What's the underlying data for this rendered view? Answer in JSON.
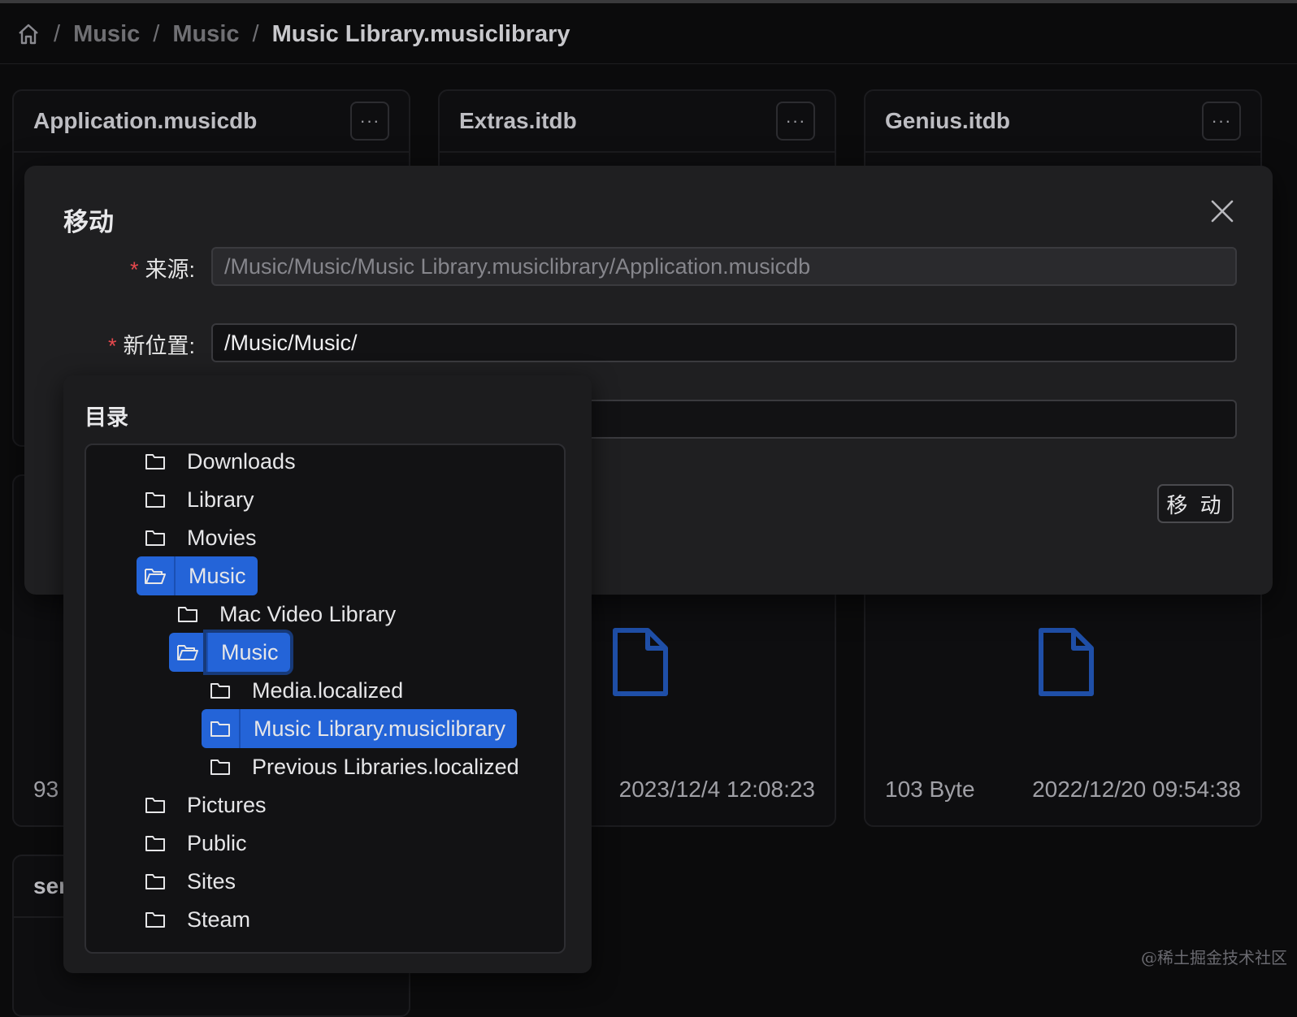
{
  "breadcrumb": {
    "home_icon": "home-icon",
    "items": [
      "Music",
      "Music",
      "Music Library.musiclibrary"
    ],
    "separator": "/"
  },
  "cards": [
    {
      "title": "Application.musicdb",
      "footer_left": "93",
      "footer_right": ""
    },
    {
      "title": "Extras.itdb",
      "footer_left": "",
      "footer_right": "2023/12/4 12:08:23"
    },
    {
      "title": "Genius.itdb",
      "footer_left": "103 Byte",
      "footer_right": "2022/12/20 09:54:38"
    },
    {
      "title": "ser"
    }
  ],
  "more_label": "···",
  "modal": {
    "title": "移动",
    "source_label": "来源:",
    "source_value": "/Music/Music/Music Library.musiclibrary/Application.musicdb",
    "dest_label": "新位置:",
    "dest_value": "/Music/Music/",
    "required_mark": "*",
    "submit_label": "移 动"
  },
  "directory": {
    "title": "目录",
    "items": [
      {
        "label": "Downloads",
        "level": 0,
        "selected": false,
        "open": false
      },
      {
        "label": "Library",
        "level": 0,
        "selected": false,
        "open": false
      },
      {
        "label": "Movies",
        "level": 0,
        "selected": false,
        "open": false
      },
      {
        "label": "Music",
        "level": 0,
        "selected": true,
        "open": true
      },
      {
        "label": "Mac Video Library",
        "level": 1,
        "selected": false,
        "open": false
      },
      {
        "label": "Music",
        "level": 1,
        "selected": true,
        "open": true,
        "focused": true
      },
      {
        "label": "Media.localized",
        "level": 2,
        "selected": false,
        "open": false
      },
      {
        "label": "Music Library.musiclibrary",
        "level": 2,
        "selected": true,
        "open": false
      },
      {
        "label": "Previous Libraries.localized",
        "level": 2,
        "selected": false,
        "open": false
      },
      {
        "label": "Pictures",
        "level": 0,
        "selected": false,
        "open": false
      },
      {
        "label": "Public",
        "level": 0,
        "selected": false,
        "open": false
      },
      {
        "label": "Sites",
        "level": 0,
        "selected": false,
        "open": false
      },
      {
        "label": "Steam",
        "level": 0,
        "selected": false,
        "open": false
      }
    ]
  },
  "watermark": "@稀土掘金技术社区",
  "colors": {
    "accent": "#2464d8",
    "required": "#e5484d",
    "file_icon": "#1f4fa8"
  }
}
